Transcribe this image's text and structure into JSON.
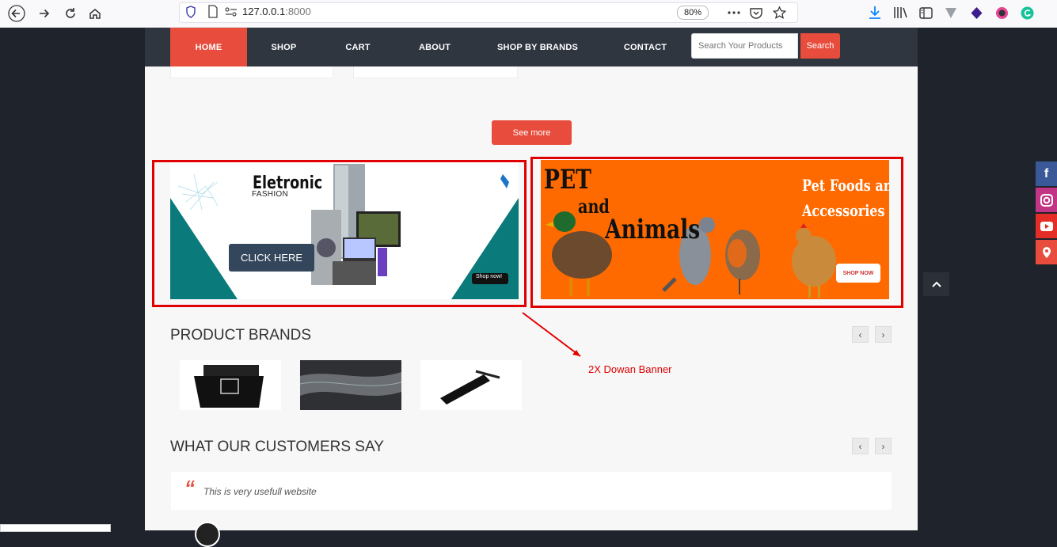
{
  "browser": {
    "url_host": "127.0.0.1",
    "url_port": ":8000",
    "zoom": "80%"
  },
  "nav": {
    "items": [
      "HOME",
      "SHOP",
      "CART",
      "ABOUT",
      "SHOP BY BRANDS",
      "CONTACT"
    ],
    "search_placeholder": "Search Your Products",
    "search_button": "Search"
  },
  "see_more": "See more",
  "banner_electronic": {
    "title": "Eletronic",
    "subtitle": "FASHION",
    "cta": "CLICK HERE",
    "shop_label": "Shop now!"
  },
  "banner_pet": {
    "title_1": "PET",
    "title_2": "and",
    "title_3": "Animals",
    "tagline_1": "Pet Foods and",
    "tagline_2": "Accessories",
    "cta": "SHOP NOW"
  },
  "annotation": "2X Dowan Banner",
  "brands": {
    "heading": "PRODUCT BRANDS",
    "prev": "‹",
    "next": "›"
  },
  "testimonials": {
    "heading": "WHAT OUR CUSTOMERS SAY",
    "prev": "‹",
    "next": "›",
    "quote_mark": "“",
    "quote": "This is very usefull website"
  },
  "social": {
    "facebook": "f"
  },
  "colors": {
    "accent": "#e74c3c",
    "nav_bg": "#2f3640",
    "annotation": "#e10000",
    "pet_banner": "#ff6a00",
    "teal": "#0b7a7a"
  }
}
